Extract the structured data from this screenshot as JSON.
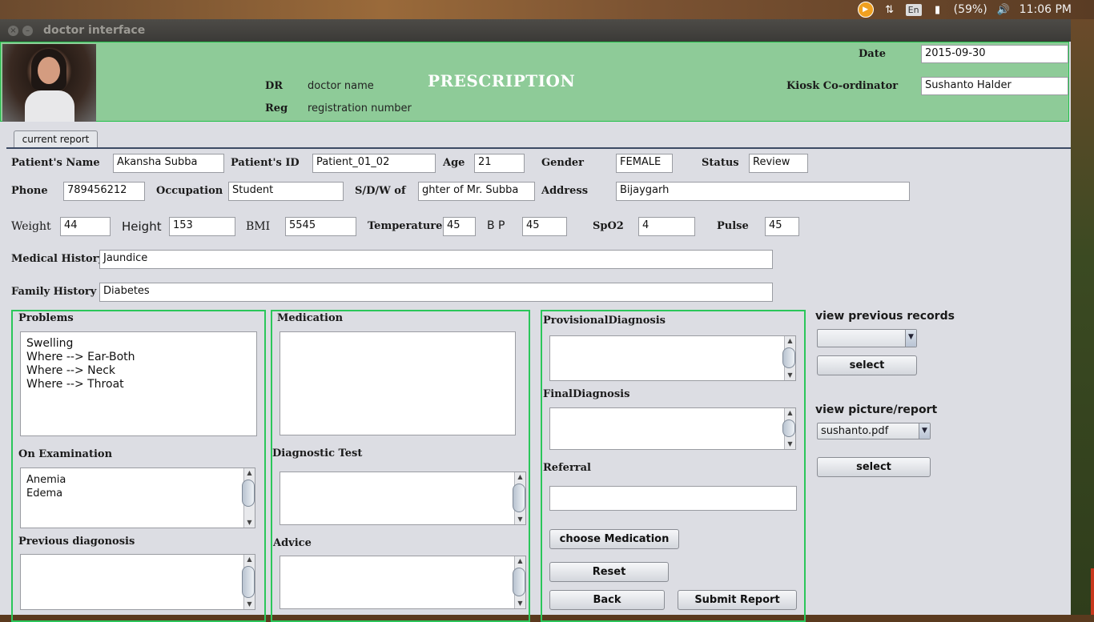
{
  "system_tray": {
    "language": "En",
    "battery": "(59%)",
    "time": "11:06 PM"
  },
  "window": {
    "title": "doctor interface"
  },
  "header": {
    "heading": "PRESCRIPTION",
    "dr_label": "DR",
    "dr_value": "doctor name",
    "reg_label": "Reg",
    "reg_value": "registration number",
    "date_label": "Date",
    "date_value": "2015-09-30",
    "kiosk_label": "Kiosk Co-ordinator",
    "kiosk_value": "Sushanto Halder"
  },
  "tabs": [
    {
      "label": "current report",
      "selected": true
    }
  ],
  "patient": {
    "name_label": "Patient's Name",
    "name": "Akansha Subba",
    "id_label": "Patient's ID",
    "id": "Patient_01_02",
    "age_label": "Age",
    "age": "21",
    "gender_label": "Gender",
    "gender": "FEMALE",
    "status_label": "Status",
    "status": "Review",
    "phone_label": "Phone",
    "phone": "789456212",
    "occupation_label": "Occupation",
    "occupation": "Student",
    "sdw_label": "S/D/W of",
    "sdw": "ghter of Mr. Subba",
    "address_label": "Address",
    "address": "Bijaygarh"
  },
  "vitals": {
    "weight_label": "Weight",
    "weight": "44",
    "height_label": "Height",
    "height": "153",
    "bmi_label": "BMI",
    "bmi": "5545",
    "temperature_label": "Temperature",
    "temperature": "45",
    "bp_label": "B P",
    "bp": "45",
    "spo2_label": "SpO2",
    "spo2": "4",
    "pulse_label": "Pulse",
    "pulse": "45"
  },
  "history": {
    "medical_label": "Medical History",
    "medical": "Jaundice",
    "family_label": "Family History",
    "family": "Diabetes"
  },
  "left_panel": {
    "problems_label": "Problems",
    "problems": [
      "Swelling",
      "Where --> Ear-Both",
      "Where --> Neck",
      "Where --> Throat"
    ],
    "examination_label": "On Examination",
    "examination": [
      "Anemia",
      "Edema"
    ],
    "previous_diagnosis_label": "Previous diagonosis"
  },
  "middle_panel": {
    "medication_label": "Medication",
    "diagnostic_test_label": "Diagnostic Test",
    "advice_label": "Advice"
  },
  "right_panel": {
    "provisional_label": "ProvisionalDiagnosis",
    "final_label": "FinalDiagnosis",
    "referral_label": "Referral",
    "choose_medication_button": "choose Medication",
    "reset_button": "Reset",
    "back_button": "Back",
    "submit_button": "Submit Report"
  },
  "side_panel": {
    "previous_records_label": "view previous  records",
    "previous_records_value": "",
    "select_button_1": "select",
    "picture_report_label": "view picture/report",
    "picture_report_value": "sushanto.pdf",
    "select_button_2": "select"
  },
  "colors": {
    "header_bg": "#8ecb98",
    "panel_border": "#2bc65a",
    "window_bg": "#dcdde3"
  }
}
